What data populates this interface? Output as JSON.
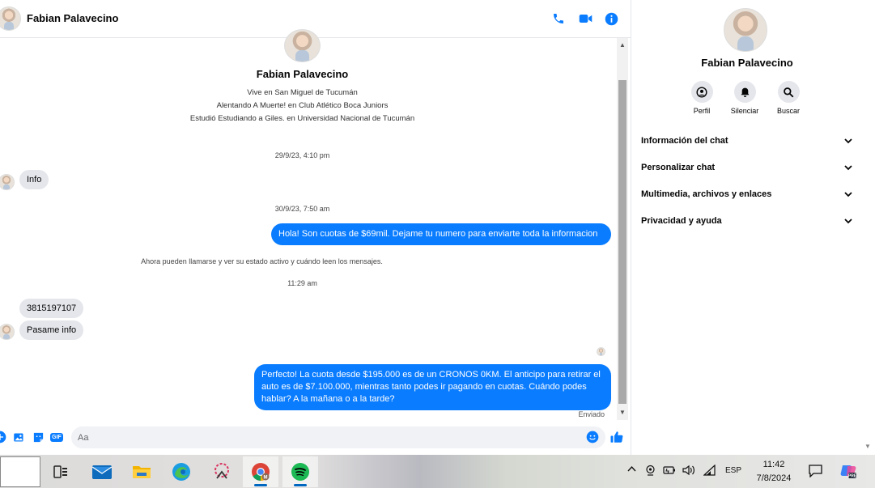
{
  "chat": {
    "contact_name": "Fabian Palavecino",
    "profile": {
      "name": "Fabian Palavecino",
      "lines": [
        "Vive en San Miguel de Tucumán",
        "Alentando A Muerte! en Club Atlético Boca Juniors",
        "Estudió Estudiando a Giles. en Universidad Nacional de Tucumán"
      ]
    },
    "timestamps": [
      "29/9/23, 4:10 pm",
      "30/9/23, 7:50 am",
      "11:29 am"
    ],
    "system_note": "Ahora pueden llamarse y ver su estado activo y cuándo leen los mensajes.",
    "messages": {
      "in_1": "Info",
      "out_1": "Hola! Son cuotas de $69mil. Dejame tu numero para enviarte toda la informacion",
      "in_2": "3815197107",
      "in_3": "Pasame info",
      "out_2": "Perfecto! La cuota desde $195.000 es de un CRONOS 0KM. El anticipo para retirar el auto es de $7.100.000, mientras tanto podes ir pagando en cuotas. Cuándo podes hablar? A la mañana o a la tarde?"
    },
    "sent_status": "Enviado",
    "composer": {
      "placeholder": "Aa",
      "gif_label": "GIF"
    }
  },
  "info_panel": {
    "name": "Fabian Palavecino",
    "actions": [
      {
        "label": "Perfil",
        "icon": "profile-icon"
      },
      {
        "label": "Silenciar",
        "icon": "bell-icon"
      },
      {
        "label": "Buscar",
        "icon": "search-icon"
      }
    ],
    "sections": [
      "Información del chat",
      "Personalizar chat",
      "Multimedia, archivos y enlaces",
      "Privacidad y ayuda"
    ]
  },
  "taskbar": {
    "tray": {
      "language": "ESP"
    },
    "clock": {
      "time": "11:42",
      "date": "7/8/2024"
    }
  },
  "colors": {
    "messenger_blue": "#0a7cff",
    "incoming_bubble": "#e4e6eb",
    "icon_blue": "#0a7cff"
  }
}
